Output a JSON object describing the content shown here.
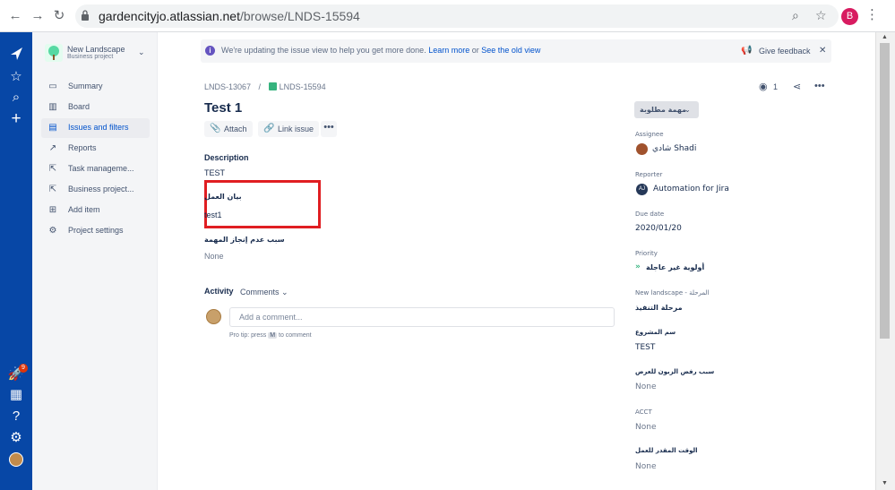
{
  "browser": {
    "url_host": "gardencityjo.atlassian.net",
    "url_path": "/browse/LNDS-15594",
    "profile_initial": "B"
  },
  "project": {
    "name": "New Landscape",
    "type": "Business project"
  },
  "sidebar": {
    "items": [
      {
        "label": "Summary",
        "icon": "summary-icon"
      },
      {
        "label": "Board",
        "icon": "board-icon"
      },
      {
        "label": "Issues and filters",
        "icon": "issues-icon"
      },
      {
        "label": "Reports",
        "icon": "reports-icon"
      },
      {
        "label": "Task manageme...",
        "icon": "shortcut-icon"
      },
      {
        "label": "Business project...",
        "icon": "shortcut-icon"
      },
      {
        "label": "Add item",
        "icon": "add-item-icon"
      },
      {
        "label": "Project settings",
        "icon": "gear-icon"
      }
    ]
  },
  "global_nav": {
    "notification_count": "9"
  },
  "banner": {
    "text": "We're updating the issue view to help you get more done.",
    "learn_more": "Learn more",
    "or": "or",
    "old_view": "See the old view",
    "feedback": "Give feedback"
  },
  "issue": {
    "parent_key": "LNDS-13067",
    "key": "LNDS-15594",
    "watchers": "1",
    "title": "Test 1",
    "attach_label": "Attach",
    "link_label": "Link issue",
    "description_label": "Description",
    "description_value": "TEST",
    "field1_label": "بيان العمل",
    "field1_value": "test1",
    "field2_label": "سبب عدم إنجاز المهمة",
    "field2_value": "None"
  },
  "activity": {
    "label": "Activity",
    "filter": "Comments",
    "placeholder": "Add a comment...",
    "protip_prefix": "Pro tip: press",
    "protip_key": "M",
    "protip_suffix": "to comment"
  },
  "details": {
    "status": "مهمة مطلوبة",
    "assignee_label": "Assignee",
    "assignee_value": "شادي Shadi",
    "reporter_label": "Reporter",
    "reporter_initials": "AJ",
    "reporter_value": "Automation for Jira",
    "due_label": "Due date",
    "due_value": "2020/01/20",
    "priority_label": "Priority",
    "priority_value": "أولوية غير عاجلة",
    "stage_label": "New landscape - المرحلة",
    "stage_value": "مرحلة التنفيذ",
    "project_name_label": "سم المشروع",
    "project_name_value": "TEST",
    "reject_label": "سبب رفض الزبون للعرض",
    "reject_value": "None",
    "acct_label": "ACCT",
    "acct_value": "None",
    "time_label": "الوقت المقدر للعمل",
    "time_value": "None"
  }
}
